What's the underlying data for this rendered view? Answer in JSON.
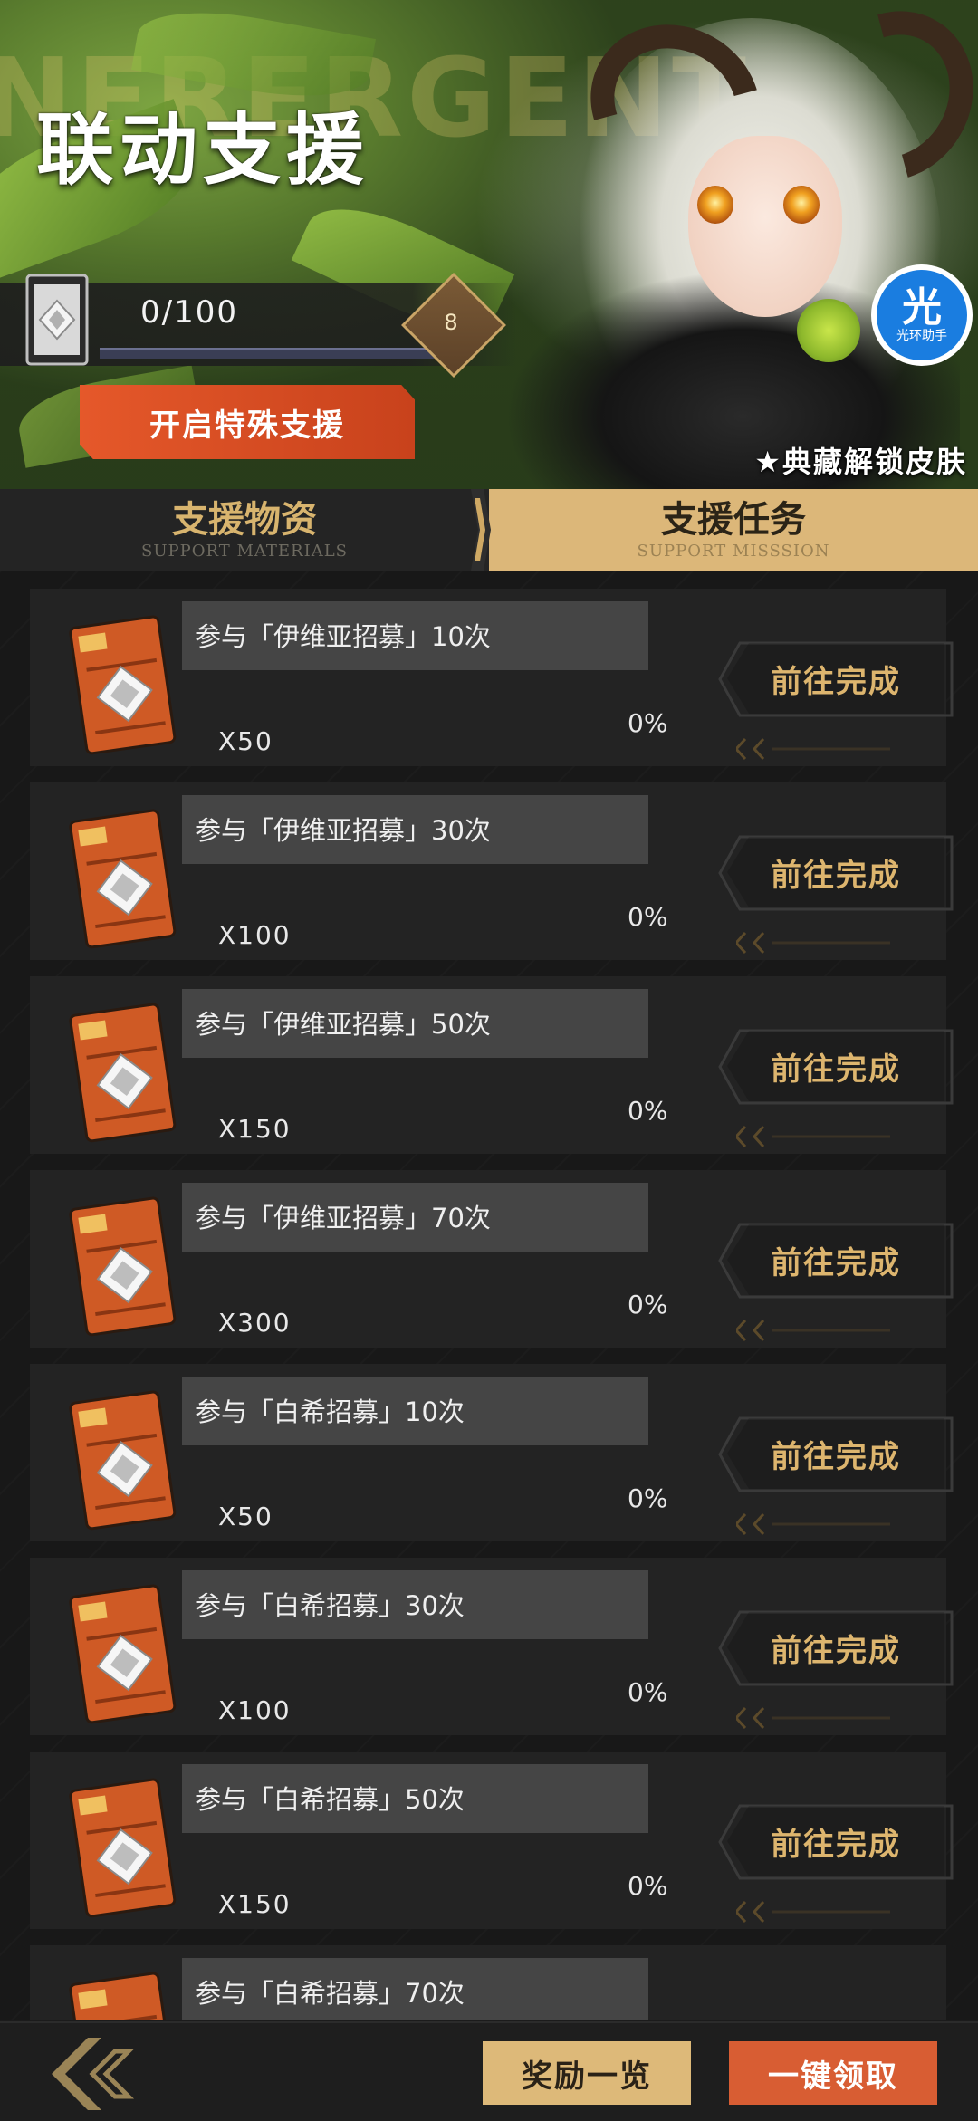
{
  "header": {
    "title": "联动支援",
    "watermark": "NERERGENT",
    "progress_text": "0/100",
    "progress_fraction": 0,
    "level": "8",
    "special_button": "开启特殊支援",
    "skin_text": "★典藏解锁皮肤"
  },
  "logo": {
    "char": "光",
    "sub": "光环助手"
  },
  "tabs": [
    {
      "label": "支援物资",
      "sub": "SUPPORT MATERIALS",
      "active": false
    },
    {
      "label": "支援任务",
      "sub": "SUPPORT MISSSION",
      "active": true
    }
  ],
  "tasks": [
    {
      "title": "参与「伊维亚招募」10次",
      "qty": "X50",
      "pct": "0%",
      "button": "前往完成"
    },
    {
      "title": "参与「伊维亚招募」30次",
      "qty": "X100",
      "pct": "0%",
      "button": "前往完成"
    },
    {
      "title": "参与「伊维亚招募」50次",
      "qty": "X150",
      "pct": "0%",
      "button": "前往完成"
    },
    {
      "title": "参与「伊维亚招募」70次",
      "qty": "X300",
      "pct": "0%",
      "button": "前往完成"
    },
    {
      "title": "参与「白希招募」10次",
      "qty": "X50",
      "pct": "0%",
      "button": "前往完成"
    },
    {
      "title": "参与「白希招募」30次",
      "qty": "X100",
      "pct": "0%",
      "button": "前往完成"
    },
    {
      "title": "参与「白希招募」50次",
      "qty": "X150",
      "pct": "0%",
      "button": "前往完成"
    },
    {
      "title": "参与「白希招募」70次",
      "qty": "",
      "pct": "",
      "button": ""
    }
  ],
  "footer": {
    "reward_button": "奖励一览",
    "claim_button": "一键领取"
  },
  "colors": {
    "gold": "#ddb979",
    "orange": "#d85d33",
    "bg": "#1b1b1b"
  }
}
